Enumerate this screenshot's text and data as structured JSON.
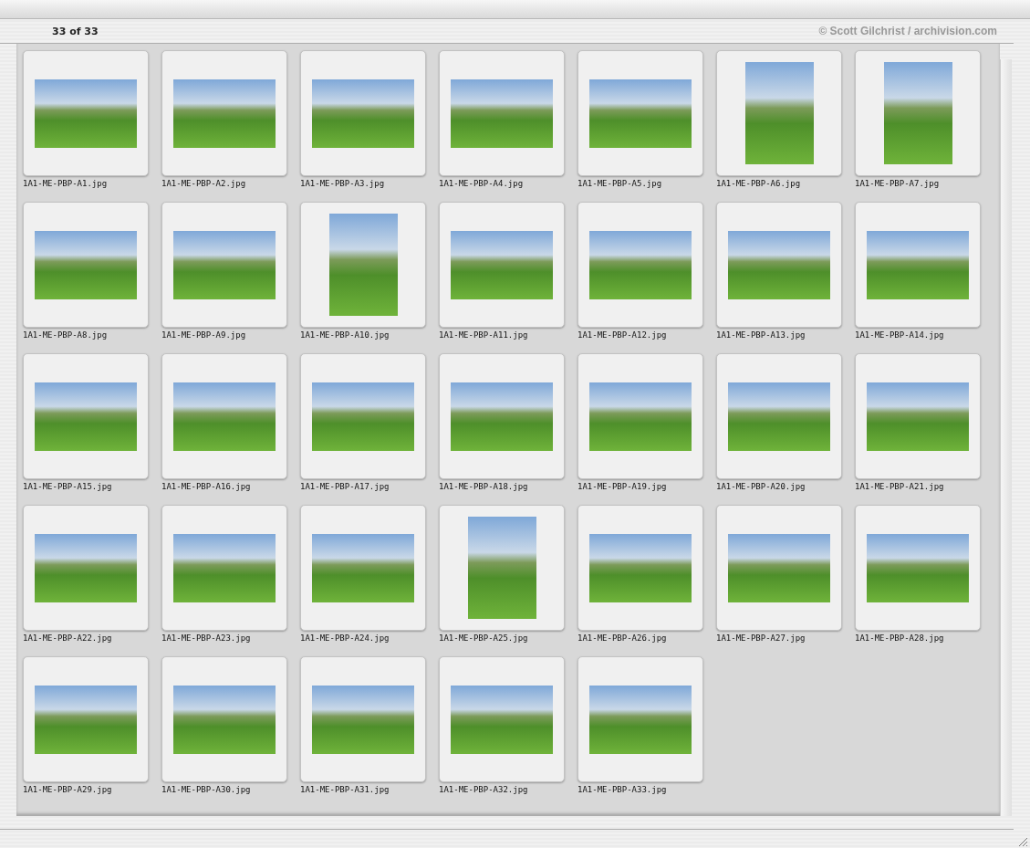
{
  "counter": "33 of 33",
  "credit": "© Scott Gilchrist / archivision.com",
  "images": [
    {
      "filename": "1A1-ME-PBP-A1.jpg",
      "kind": "landscape"
    },
    {
      "filename": "1A1-ME-PBP-A2.jpg",
      "kind": "landscape"
    },
    {
      "filename": "1A1-ME-PBP-A3.jpg",
      "kind": "landscape"
    },
    {
      "filename": "1A1-ME-PBP-A4.jpg",
      "kind": "landscape"
    },
    {
      "filename": "1A1-ME-PBP-A5.jpg",
      "kind": "landscape"
    },
    {
      "filename": "1A1-ME-PBP-A6.jpg",
      "kind": "portrait"
    },
    {
      "filename": "1A1-ME-PBP-A7.jpg",
      "kind": "portrait"
    },
    {
      "filename": "1A1-ME-PBP-A8.jpg",
      "kind": "landscape"
    },
    {
      "filename": "1A1-ME-PBP-A9.jpg",
      "kind": "landscape"
    },
    {
      "filename": "1A1-ME-PBP-A10.jpg",
      "kind": "portrait"
    },
    {
      "filename": "1A1-ME-PBP-A11.jpg",
      "kind": "landscape"
    },
    {
      "filename": "1A1-ME-PBP-A12.jpg",
      "kind": "landscape"
    },
    {
      "filename": "1A1-ME-PBP-A13.jpg",
      "kind": "landscape"
    },
    {
      "filename": "1A1-ME-PBP-A14.jpg",
      "kind": "landscape"
    },
    {
      "filename": "1A1-ME-PBP-A15.jpg",
      "kind": "landscape"
    },
    {
      "filename": "1A1-ME-PBP-A16.jpg",
      "kind": "landscape"
    },
    {
      "filename": "1A1-ME-PBP-A17.jpg",
      "kind": "landscape"
    },
    {
      "filename": "1A1-ME-PBP-A18.jpg",
      "kind": "landscape"
    },
    {
      "filename": "1A1-ME-PBP-A19.jpg",
      "kind": "landscape"
    },
    {
      "filename": "1A1-ME-PBP-A20.jpg",
      "kind": "landscape"
    },
    {
      "filename": "1A1-ME-PBP-A21.jpg",
      "kind": "landscape"
    },
    {
      "filename": "1A1-ME-PBP-A22.jpg",
      "kind": "landscape"
    },
    {
      "filename": "1A1-ME-PBP-A23.jpg",
      "kind": "landscape"
    },
    {
      "filename": "1A1-ME-PBP-A24.jpg",
      "kind": "landscape"
    },
    {
      "filename": "1A1-ME-PBP-A25.jpg",
      "kind": "portrait"
    },
    {
      "filename": "1A1-ME-PBP-A26.jpg",
      "kind": "landscape"
    },
    {
      "filename": "1A1-ME-PBP-A27.jpg",
      "kind": "landscape"
    },
    {
      "filename": "1A1-ME-PBP-A28.jpg",
      "kind": "landscape"
    },
    {
      "filename": "1A1-ME-PBP-A29.jpg",
      "kind": "landscape"
    },
    {
      "filename": "1A1-ME-PBP-A30.jpg",
      "kind": "landscape"
    },
    {
      "filename": "1A1-ME-PBP-A31.jpg",
      "kind": "landscape"
    },
    {
      "filename": "1A1-ME-PBP-A32.jpg",
      "kind": "landscape"
    },
    {
      "filename": "1A1-ME-PBP-A33.jpg",
      "kind": "landscape"
    }
  ]
}
